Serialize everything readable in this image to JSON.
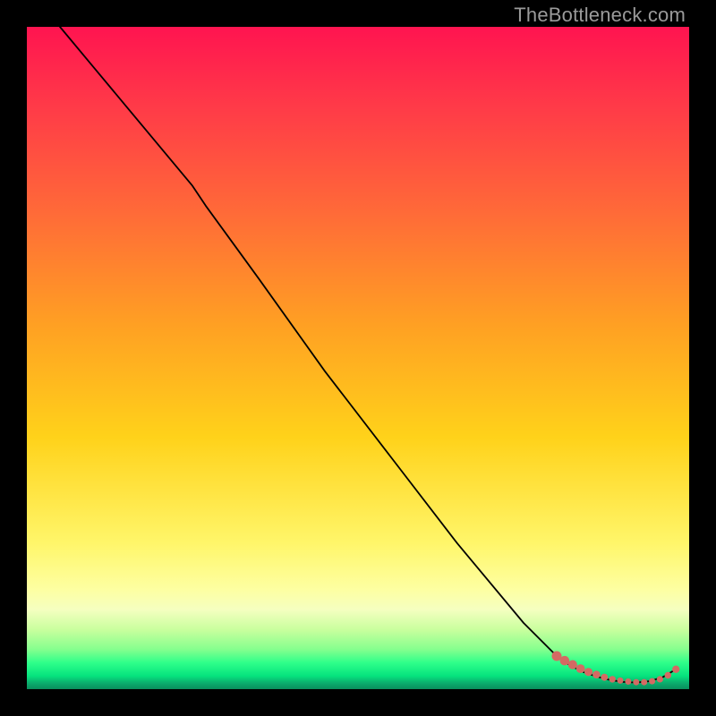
{
  "watermark": "TheBottleneck.com",
  "colors": {
    "marker": "#d46a63",
    "line": "#000000"
  },
  "chart_data": {
    "type": "line",
    "title": "",
    "xlabel": "",
    "ylabel": "",
    "xlim": [
      0,
      100
    ],
    "ylim": [
      0,
      100
    ],
    "grid": false,
    "legend": false,
    "note": "Axis ticks and numeric labels are not rendered in the image; x/y are normalized 0–100 estimated from pixel positions.",
    "series": [
      {
        "name": "bottleneck-curve",
        "x": [
          5,
          10,
          15,
          20,
          25,
          27,
          35,
          45,
          55,
          65,
          75,
          80,
          82,
          84,
          86,
          88,
          90,
          92,
          94,
          96,
          98
        ],
        "y": [
          100,
          94,
          88,
          82,
          76,
          73,
          62,
          48,
          35,
          22,
          10,
          5,
          3.6,
          2.6,
          1.9,
          1.4,
          1.1,
          1.0,
          1.2,
          1.8,
          3.0
        ]
      }
    ],
    "markers": {
      "name": "highlight-points",
      "x": [
        80,
        81.2,
        82.4,
        83.6,
        84.8,
        86,
        87.2,
        88.4,
        89.6,
        90.8,
        92,
        93.2,
        94.4,
        95.6,
        96.8,
        98
      ],
      "y": [
        5.0,
        4.3,
        3.7,
        3.1,
        2.6,
        2.2,
        1.8,
        1.5,
        1.3,
        1.15,
        1.05,
        1.05,
        1.2,
        1.5,
        2.1,
        3.0
      ],
      "r": [
        5.5,
        5.3,
        5.1,
        4.9,
        4.6,
        4.3,
        4.0,
        3.7,
        3.5,
        3.5,
        3.5,
        3.5,
        3.5,
        3.6,
        3.8,
        4.2
      ]
    }
  }
}
